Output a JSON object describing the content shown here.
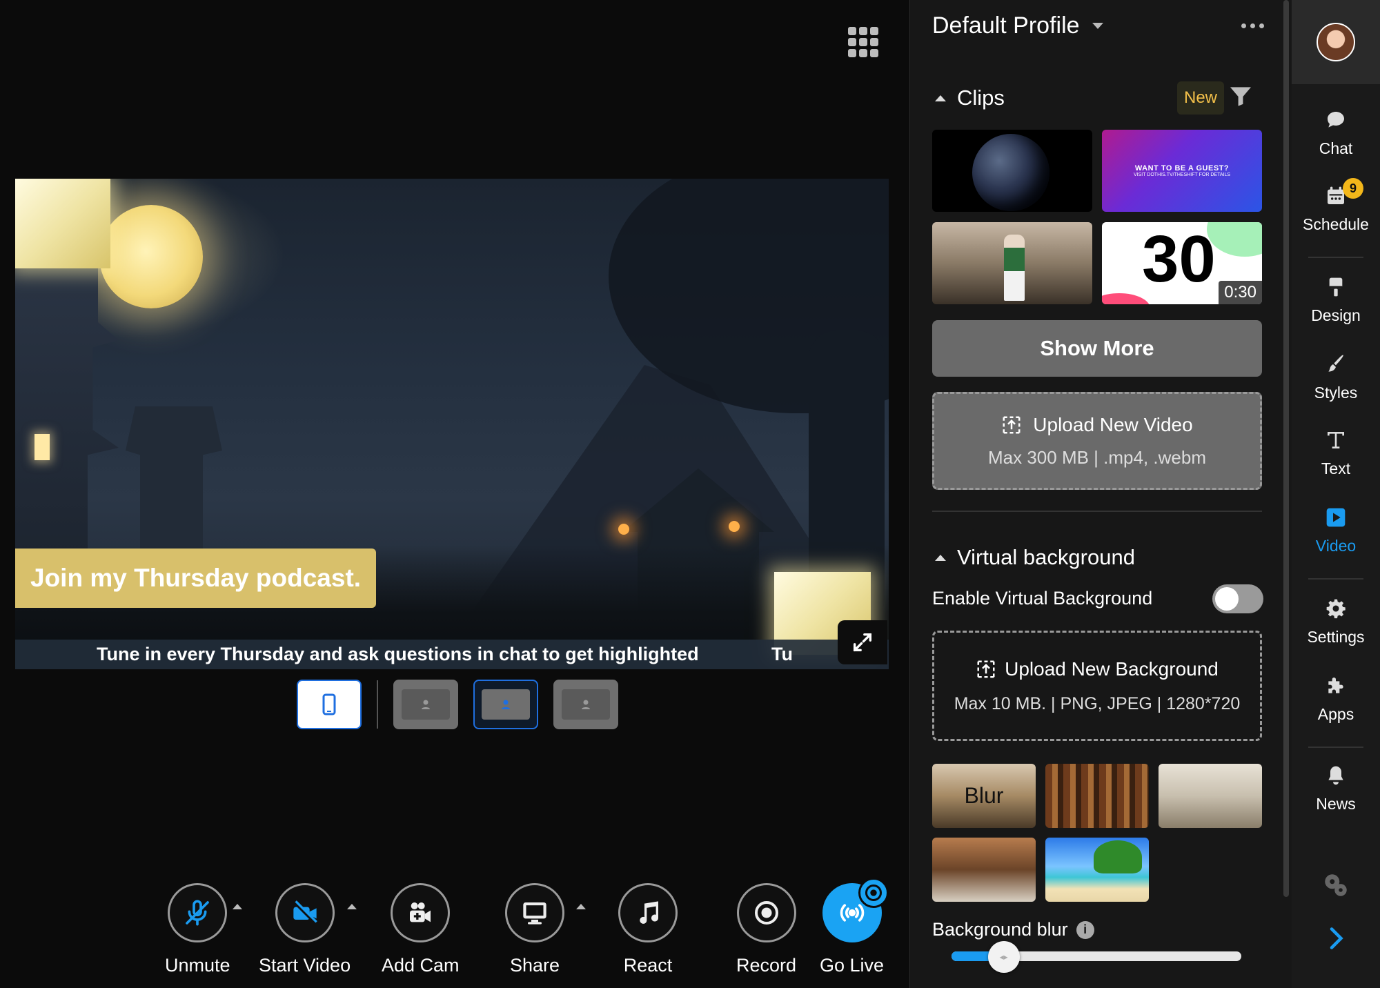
{
  "stage": {
    "banner_text": "Join my Thursday podcast.",
    "ticker_text": "Tune in every Thursday and ask questions in chat to get highlighted",
    "ticker_text_2": "Tu"
  },
  "controls": [
    {
      "label": "Unmute",
      "icon": "mic-off-icon"
    },
    {
      "label": "Start Video",
      "icon": "video-off-icon"
    },
    {
      "label": "Add Cam",
      "icon": "add-cam-icon"
    },
    {
      "label": "Share",
      "icon": "monitor-icon"
    },
    {
      "label": "React",
      "icon": "music-note-icon"
    },
    {
      "label": "Record",
      "icon": "record-icon"
    },
    {
      "label": "Go Live",
      "icon": "broadcast-icon"
    }
  ],
  "panel": {
    "profile_title": "Default Profile",
    "clips": {
      "title": "Clips",
      "new_badge": "New",
      "guest_clip_line1": "WANT TO BE A GUEST?",
      "guest_clip_line2": "VISIT DOTHIS.TV/THESHIFT FOR DETAILS",
      "countdown_number": "30",
      "countdown_duration": "0:30",
      "show_more": "Show More",
      "upload_title": "Upload New Video",
      "upload_hint": "Max 300 MB | .mp4, .webm"
    },
    "virtual_background": {
      "title": "Virtual background",
      "enable_label": "Enable Virtual Background",
      "enabled": false,
      "upload_title": "Upload New Background",
      "upload_hint": "Max 10 MB. | PNG, JPEG | 1280*720",
      "blur_thumb_label": "Blur",
      "blur_label": "Background blur",
      "blur_level": 0.18
    }
  },
  "nav": [
    {
      "label": "Chat",
      "icon": "chat-icon"
    },
    {
      "label": "Schedule",
      "icon": "calendar-icon",
      "badge": "9"
    },
    {
      "label": "Design",
      "icon": "brush-icon"
    },
    {
      "label": "Styles",
      "icon": "paint-brush-icon"
    },
    {
      "label": "Text",
      "icon": "text-icon"
    },
    {
      "label": "Video",
      "icon": "video-icon",
      "active": true
    },
    {
      "label": "Settings",
      "icon": "gear-icon"
    },
    {
      "label": "Apps",
      "icon": "puzzle-icon"
    },
    {
      "label": "News",
      "icon": "bell-icon"
    }
  ],
  "colors": {
    "accent": "#1a9bf0",
    "banner": "#d8c06b",
    "new_badge": "#f3c04a",
    "schedule_badge": "#f3b71a"
  }
}
